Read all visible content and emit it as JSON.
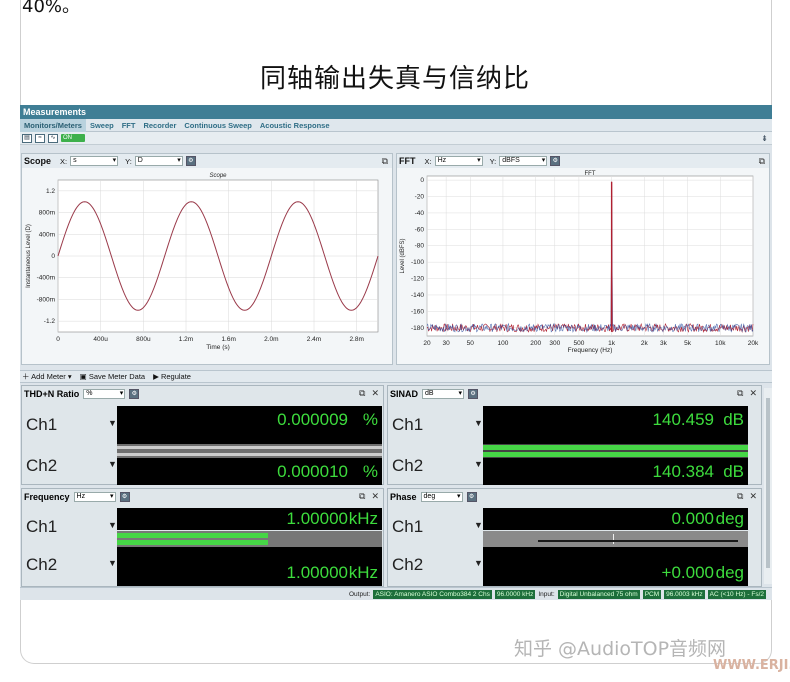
{
  "top_text": "40%。",
  "heading": "同轴输出失真与信纳比",
  "app": {
    "title": "Measurements",
    "tabs": [
      "Monitors/Meters",
      "Sweep",
      "FFT",
      "Recorder",
      "Continuous Sweep",
      "Acoustic Response"
    ],
    "on_label": "ON",
    "toolbar_icons": [
      "save-icon",
      "graph-icon",
      "chart-icon"
    ]
  },
  "scope": {
    "title": "Scope",
    "x_label": "X:",
    "x_unit": "s",
    "y_label": "Y:",
    "y_unit": "D",
    "chart_data": {
      "type": "line",
      "title": "Scope",
      "xlabel": "Time (s)",
      "ylabel": "Instantaneous Level (D)",
      "x_ticks": [
        "0",
        "400u",
        "800u",
        "1.2m",
        "1.6m",
        "2.0m",
        "2.4m",
        "2.8m"
      ],
      "y_ticks": [
        "1.2",
        "800m",
        "400m",
        "0",
        "-400m",
        "-800m",
        "-1.2"
      ],
      "xlim": [
        0,
        0.003
      ],
      "ylim": [
        -1.4,
        1.4
      ],
      "series": [
        {
          "x_start": 0,
          "x_end": 0.003,
          "frequency_hz": 1000,
          "amplitude": 1.0,
          "color": "#9a3a4a"
        }
      ]
    }
  },
  "fft": {
    "title": "FFT",
    "x_label": "X:",
    "x_unit": "Hz",
    "y_label": "Y:",
    "y_unit": "dBFS",
    "chart_data": {
      "type": "line",
      "title": "FFT",
      "xlabel": "Frequency (Hz)",
      "ylabel": "Level (dBFS)",
      "x_ticks": [
        "20",
        "30",
        "50",
        "100",
        "200",
        "300",
        "500",
        "1k",
        "2k",
        "3k",
        "5k",
        "10k",
        "20k"
      ],
      "y_ticks": [
        "0",
        "-20",
        "-40",
        "-60",
        "-80",
        "-100",
        "-120",
        "-140",
        "-160",
        "-180"
      ],
      "xlim": [
        20,
        20000
      ],
      "ylim": [
        -190,
        5
      ],
      "x_scale": "log",
      "peak": {
        "x": 1000,
        "y": -2
      },
      "noise_floor_db": [
        -185,
        -175
      ],
      "series_colors": [
        "#b02030",
        "#3050a0"
      ]
    }
  },
  "meter_toolbar": {
    "add_meter": "Add Meter",
    "save_data": "Save Meter Data",
    "regulate": "Regulate"
  },
  "meters": {
    "thd": {
      "title": "THD+N Ratio",
      "unit_select": "%",
      "ch1": {
        "label": "Ch1",
        "value": "0.000009",
        "unit": "%",
        "bar_fraction": 0.0
      },
      "ch2": {
        "label": "Ch2",
        "value": "0.000010",
        "unit": "%",
        "bar_fraction": 0.0
      }
    },
    "sinad": {
      "title": "SINAD",
      "unit_select": "dB",
      "ch1": {
        "label": "Ch1",
        "value": "140.459",
        "unit": "dB",
        "bar_fraction": 1.0
      },
      "ch2": {
        "label": "Ch2",
        "value": "140.384",
        "unit": "dB",
        "bar_fraction": 1.0
      }
    },
    "freq": {
      "title": "Frequency",
      "unit_select": "Hz",
      "ch1": {
        "label": "Ch1",
        "value": "1.00000",
        "unit": "kHz",
        "bar_fraction": 0.57
      },
      "ch2": {
        "label": "Ch2",
        "value": "1.00000",
        "unit": "kHz",
        "bar_fraction": 0.0
      }
    },
    "phase": {
      "title": "Phase",
      "unit_select": "deg",
      "ch1": {
        "label": "Ch1",
        "value": "0.000",
        "unit": "deg",
        "bar_fraction": 0.0
      },
      "ch2": {
        "label": "Ch2",
        "value": "+0.000",
        "unit": "deg",
        "bar_fraction": 0.0
      }
    }
  },
  "status": {
    "output_label": "Output:",
    "output_device": "ASIO: Amanero ASIO Combo384 2 Chs",
    "output_rate": "96.0000 kHz",
    "input_label": "Input:",
    "input_device": "Digital Unbalanced 75 ohm",
    "input_format": "PCM",
    "input_rate": "96.0003 kHz",
    "input_coupling": "AC (<10 Hz) - Fs/2"
  },
  "watermark": "知乎 @AudioTOP音频网",
  "watermark2": "WWW.ERJI.NET",
  "colors": {
    "accent": "#3f7e95",
    "meter_green": "#3ddc3d",
    "scope_trace": "#9a3a4a"
  }
}
